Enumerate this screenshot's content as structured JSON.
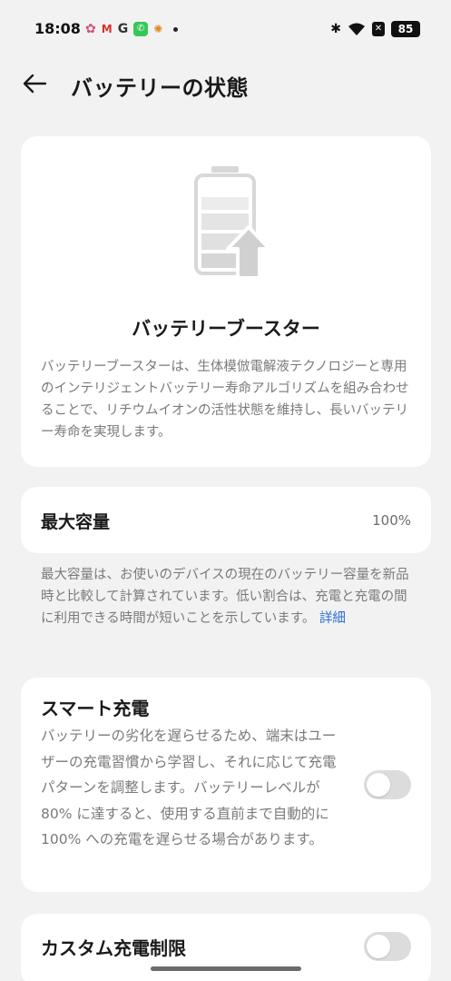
{
  "status_bar": {
    "time": "18:08",
    "notification_icons": [
      "flower-icon",
      "gmail-icon",
      "google-icon",
      "phone-icon",
      "chat-icon"
    ],
    "battery_level": "85"
  },
  "header": {
    "title": "バッテリーの状態"
  },
  "booster": {
    "title": "バッテリーブースター",
    "description": "バッテリーブースターは、生体模倣電解液テクノロジーと専用のインテリジェントバッテリー寿命アルゴリズムを組み合わせることで、リチウムイオンの活性状態を維持し、長いバッテリー寿命を実現します。"
  },
  "capacity": {
    "label": "最大容量",
    "value": "100%",
    "note": "最大容量は、お使いのデバイスの現在のバッテリー容量を新品時と比較して計算されています。低い割合は、充電と充電の間に利用できる時間が短いことを示しています。",
    "link": "詳細"
  },
  "smart_charging": {
    "title": "スマート充電",
    "description": "バッテリーの劣化を遅らせるため、端末はユーザーの充電習慣から学習し、それに応じて充電パターンを調整します。バッテリーレベルが 80% に達すると、使用する直前まで自動的に 100% への充電を遅らせる場合があります。",
    "enabled": false
  },
  "custom_limit": {
    "title": "カスタム充電制限",
    "enabled": false
  },
  "colors": {
    "background": "#f2f2f2",
    "card": "#ffffff",
    "link": "#2d6fd8",
    "toggle_off": "#dcdcdc"
  }
}
